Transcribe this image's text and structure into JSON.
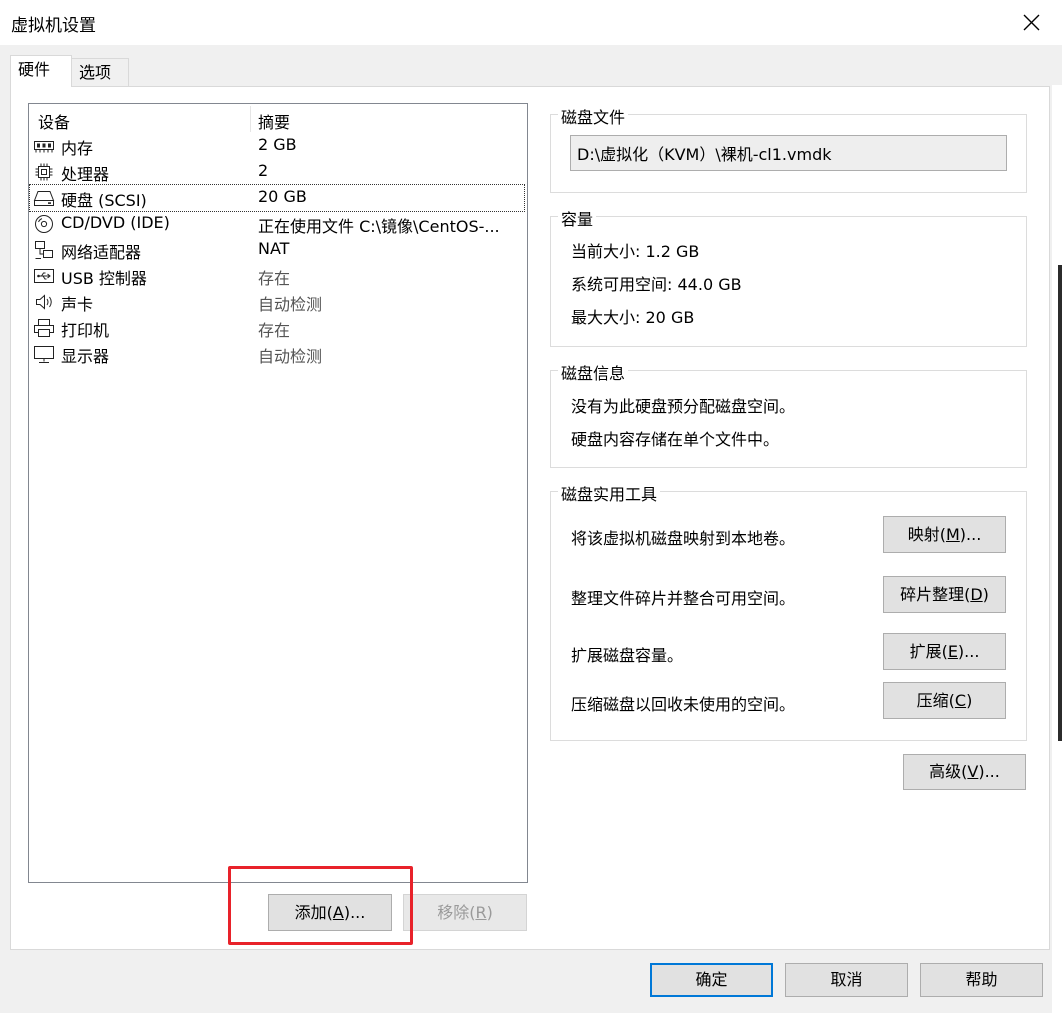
{
  "window": {
    "title": "虚拟机设置"
  },
  "tabs": [
    {
      "label": "硬件"
    },
    {
      "label": "选项"
    }
  ],
  "device_list": {
    "columns": {
      "device": "设备",
      "summary": "摘要"
    },
    "rows": [
      {
        "icon": "memory-icon",
        "name": "内存",
        "summary": "2 GB"
      },
      {
        "icon": "processor-icon",
        "name": "处理器",
        "summary": "2"
      },
      {
        "icon": "hard-disk-icon",
        "name": "硬盘 (SCSI)",
        "summary": "20 GB"
      },
      {
        "icon": "cd-dvd-icon",
        "name": "CD/DVD (IDE)",
        "summary": "正在使用文件 C:\\镜像\\CentOS-..."
      },
      {
        "icon": "network-adapter-icon",
        "name": "网络适配器",
        "summary": "NAT"
      },
      {
        "icon": "usb-icon",
        "name": "USB 控制器",
        "summary": "存在"
      },
      {
        "icon": "sound-card-icon",
        "name": "声卡",
        "summary": "自动检测"
      },
      {
        "icon": "printer-icon",
        "name": "打印机",
        "summary": "存在"
      },
      {
        "icon": "display-icon",
        "name": "显示器",
        "summary": "自动检测"
      }
    ],
    "selected_index": 2
  },
  "list_buttons": {
    "add": {
      "text": "添加(",
      "key": "A",
      "tail": ")..."
    },
    "remove": {
      "text": "移除(",
      "key": "R",
      "tail": ")"
    }
  },
  "disk_file": {
    "title": "磁盘文件",
    "path": "D:\\虚拟化（KVM）\\裸机-cl1.vmdk"
  },
  "capacity": {
    "title": "容量",
    "current_label": "当前大小:",
    "current_value": "1.2 GB",
    "available_label": "系统可用空间:",
    "available_value": "44.0 GB",
    "max_label": "最大大小:",
    "max_value": "20 GB"
  },
  "disk_info": {
    "title": "磁盘信息",
    "line1": "没有为此硬盘预分配磁盘空间。",
    "line2": "硬盘内容存储在单个文件中。"
  },
  "disk_tools": {
    "title": "磁盘实用工具",
    "map": {
      "desc": "将该虚拟机磁盘映射到本地卷。",
      "text": "映射(",
      "key": "M",
      "tail": ")..."
    },
    "defrag": {
      "desc": "整理文件碎片并整合可用空间。",
      "text": "碎片整理(",
      "key": "D",
      "tail": ")"
    },
    "expand": {
      "desc": "扩展磁盘容量。",
      "text": "扩展(",
      "key": "E",
      "tail": ")..."
    },
    "compact": {
      "desc": "压缩磁盘以回收未使用的空间。",
      "text": "压缩(",
      "key": "C",
      "tail": ")"
    }
  },
  "advanced": {
    "text": "高级(",
    "key": "V",
    "tail": ")..."
  },
  "footer": {
    "ok": "确定",
    "cancel": "取消",
    "help": "帮助"
  },
  "highlight_color": "#e8222a"
}
